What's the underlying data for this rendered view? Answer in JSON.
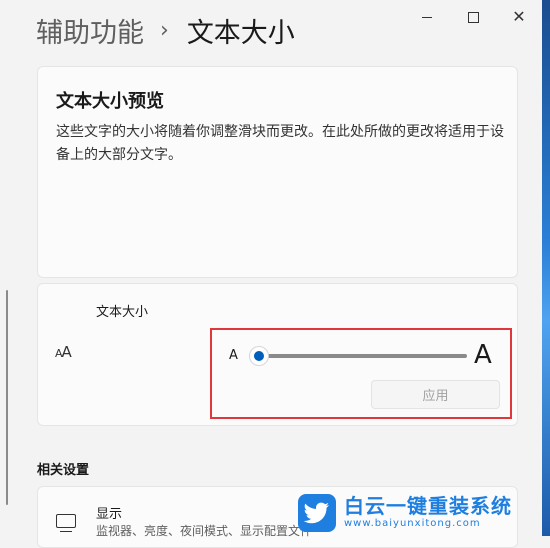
{
  "breadcrumb": {
    "parent": "辅助功能",
    "separator": "›",
    "current": "文本大小"
  },
  "window_controls": {
    "minimize": "minimize",
    "maximize": "maximize",
    "close": "✕"
  },
  "preview": {
    "title": "文本大小预览",
    "description": "这些文字的大小将随着你调整滑块而更改。在此处所做的更改将适用于设备上的大部分文字。"
  },
  "text_size": {
    "label": "文本大小",
    "icon_small": "A",
    "icon_large": "A",
    "slider_min_label": "A",
    "slider_max_label": "A",
    "slider_value_fraction": 0.0,
    "apply_label": "应用",
    "apply_enabled": false
  },
  "related_settings": {
    "title": "相关设置",
    "display": {
      "title": "显示",
      "subtitle": "监视器、亮度、夜间模式、显示配置文件"
    }
  },
  "watermark": {
    "title": "白云一键重装系统",
    "url": "www.baiyunxitong.com"
  },
  "colors": {
    "accent": "#005fb8",
    "highlight_border": "#e0373c",
    "watermark": "#1f7fe0"
  }
}
